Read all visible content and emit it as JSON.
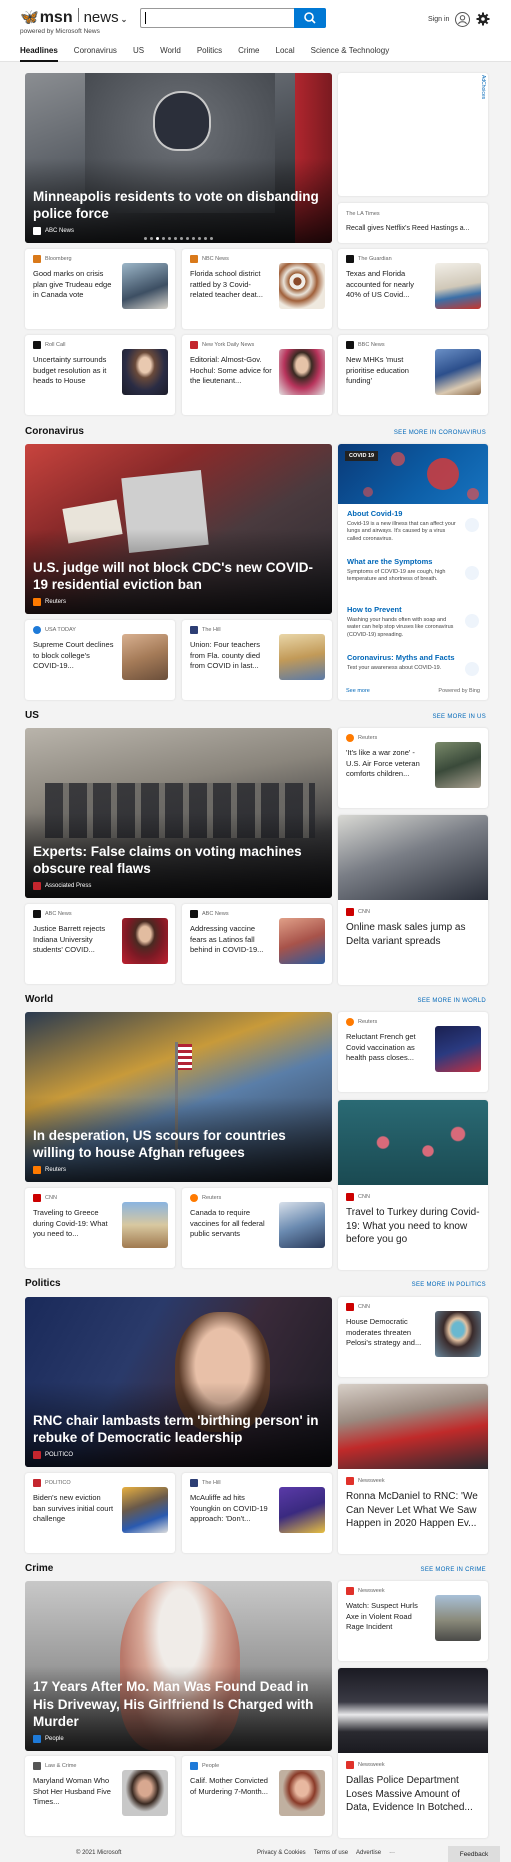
{
  "header": {
    "logo_bird": "🦋",
    "logo_msn": "msn",
    "logo_news": "news",
    "logo_caret": "⌄",
    "powered_by": "powered by Microsoft News",
    "signin": "Sign in"
  },
  "nav": [
    "Headlines",
    "Coronavirus",
    "US",
    "World",
    "Politics",
    "Crime",
    "Local",
    "Science & Technology"
  ],
  "top": {
    "hero": {
      "title": "Minneapolis residents to vote on disbanding police force",
      "source": "ABC News",
      "source_color": "#111111"
    },
    "ad_label": "AdChoices",
    "ad_story": {
      "source": "The LA Times",
      "title": "Recall gives Netflix's Reed Hastings a..."
    },
    "cards": [
      {
        "source": "Bloomberg",
        "title": "Good marks on crisis plan give Trudeau edge in Canada vote",
        "color": "#d9791a"
      },
      {
        "source": "NBC News",
        "title": "Florida school district rattled by 3 Covid-related teacher deat...",
        "color": "#d9791a"
      },
      {
        "source": "The Guardian",
        "title": "Texas and Florida accounted for nearly 40% of US Covid...",
        "color": "#111111"
      },
      {
        "source": "Roll Call",
        "title": "Uncertainty surrounds budget resolution as it heads to House",
        "color": "#111111"
      },
      {
        "source": "New York Daily News",
        "title": "Editorial: Almost-Gov. Hochul: Some advice for the lieutenant...",
        "color": "#c4262e"
      },
      {
        "source": "BBC News",
        "title": "New MHKs 'must prioritise education funding'",
        "color": "#111111"
      }
    ]
  },
  "coronavirus": {
    "title": "Coronavirus",
    "see_more": "SEE MORE IN CORONAVIRUS",
    "hero": {
      "title": "U.S. judge will not block CDC's new COVID-19 residential eviction ban",
      "source": "Reuters",
      "source_color": "#ff7a00"
    },
    "cards": [
      {
        "source": "USA TODAY",
        "title": "Supreme Court declines to block college's COVID-19...",
        "color": "#1e7ad8"
      },
      {
        "source": "The Hill",
        "title": "Union: Four teachers from Fla. county died from COVID in last...",
        "color": "#2d3e74"
      }
    ],
    "widget": {
      "badge": "COVID 19",
      "items": [
        {
          "heading": "About Covid-19",
          "desc": "Covid-19 is a new illness that can affect your lungs and airways. It's caused by a virus called coronavirus."
        },
        {
          "heading": "What are the Symptoms",
          "desc": "Symptoms of COVID-19 are cough, high temperature and shortness of breath."
        },
        {
          "heading": "How to Prevent",
          "desc": "Washing your hands often with soap and water can help stop viruses like coronavirus (COVID-19) spreading."
        },
        {
          "heading": "Coronavirus: Myths and Facts",
          "desc": "Test your awareness about COVID-19."
        }
      ],
      "see_more": "See more",
      "powered": "Powered by Bing"
    }
  },
  "us": {
    "title": "US",
    "see_more": "SEE MORE IN US",
    "hero": {
      "title": "Experts: False claims on voting machines obscure real flaws",
      "source": "Associated Press",
      "source_color": "#c4262e"
    },
    "side_card": {
      "source": "Reuters",
      "title": "'It's like a war zone' - U.S. Air Force veteran comforts children...",
      "color": "#ff7a00"
    },
    "tall": {
      "source": "CNN",
      "title": "Online mask sales jump as Delta variant spreads",
      "color": "#cc0000"
    },
    "cards": [
      {
        "source": "ABC News",
        "title": "Justice Barrett rejects Indiana University students' COVID...",
        "color": "#111111"
      },
      {
        "source": "ABC News",
        "title": "Addressing vaccine fears as Latinos fall behind in COVID-19...",
        "color": "#111111"
      }
    ]
  },
  "world": {
    "title": "World",
    "see_more": "SEE MORE IN WORLD",
    "hero": {
      "title": "In desperation, US scours for countries willing to house Afghan refugees",
      "source": "Reuters",
      "source_color": "#ff7a00"
    },
    "side_card": {
      "source": "Reuters",
      "title": "Reluctant French get Covid vaccination as health pass closes...",
      "color": "#ff7a00"
    },
    "tall": {
      "source": "CNN",
      "title": "Travel to Turkey during Covid-19: What you need to know before you go",
      "color": "#cc0000"
    },
    "cards": [
      {
        "source": "CNN",
        "title": "Traveling to Greece during Covid-19: What you need to...",
        "color": "#cc0000"
      },
      {
        "source": "Reuters",
        "title": "Canada to require vaccines for all federal public servants",
        "color": "#ff7a00"
      }
    ]
  },
  "politics": {
    "title": "Politics",
    "see_more": "SEE MORE IN POLITICS",
    "hero": {
      "title": "RNC chair lambasts term 'birthing person' in rebuke of Democratic leadership",
      "source": "POLITICO",
      "source_color": "#c4262e"
    },
    "side_card": {
      "source": "CNN",
      "title": "House Democratic moderates threaten Pelosi's strategy and...",
      "color": "#cc0000"
    },
    "tall": {
      "source": "Newsweek",
      "title": "Ronna McDaniel to RNC: 'We Can Never Let What We Saw Happen in 2020 Happen Ev...",
      "color": "#e0312a"
    },
    "cards": [
      {
        "source": "POLITICO",
        "title": "Biden's new eviction ban survives initial court challenge",
        "color": "#c4262e"
      },
      {
        "source": "The Hill",
        "title": "McAuliffe ad hits Youngkin on COVID-19 approach: 'Don't...",
        "color": "#2d3e74"
      }
    ]
  },
  "crime": {
    "title": "Crime",
    "see_more": "SEE MORE IN CRIME",
    "hero": {
      "title": "17 Years After Mo. Man Was Found Dead in His Driveway, His Girlfriend Is Charged with Murder",
      "source": "People",
      "source_color": "#1e7ad8"
    },
    "side_card": {
      "source": "Newsweek",
      "title": "Watch: Suspect Hurls Axe in Violent Road Rage Incident",
      "color": "#e0312a"
    },
    "tall": {
      "source": "Newsweek",
      "title": "Dallas Police Department Loses Massive Amount of Data, Evidence In Botched...",
      "color": "#e0312a"
    },
    "cards": [
      {
        "source": "Law & Crime",
        "title": "Maryland Woman Who Shot Her Husband Five Times...",
        "color": "#555555"
      },
      {
        "source": "People",
        "title": "Calif. Mother Convicted of Murdering 7-Month...",
        "color": "#1e7ad8"
      }
    ]
  },
  "footer": {
    "copyright": "© 2021 Microsoft",
    "links": [
      "Privacy & Cookies",
      "Terms of use",
      "Advertise",
      "···"
    ],
    "feedback": "Feedback"
  }
}
